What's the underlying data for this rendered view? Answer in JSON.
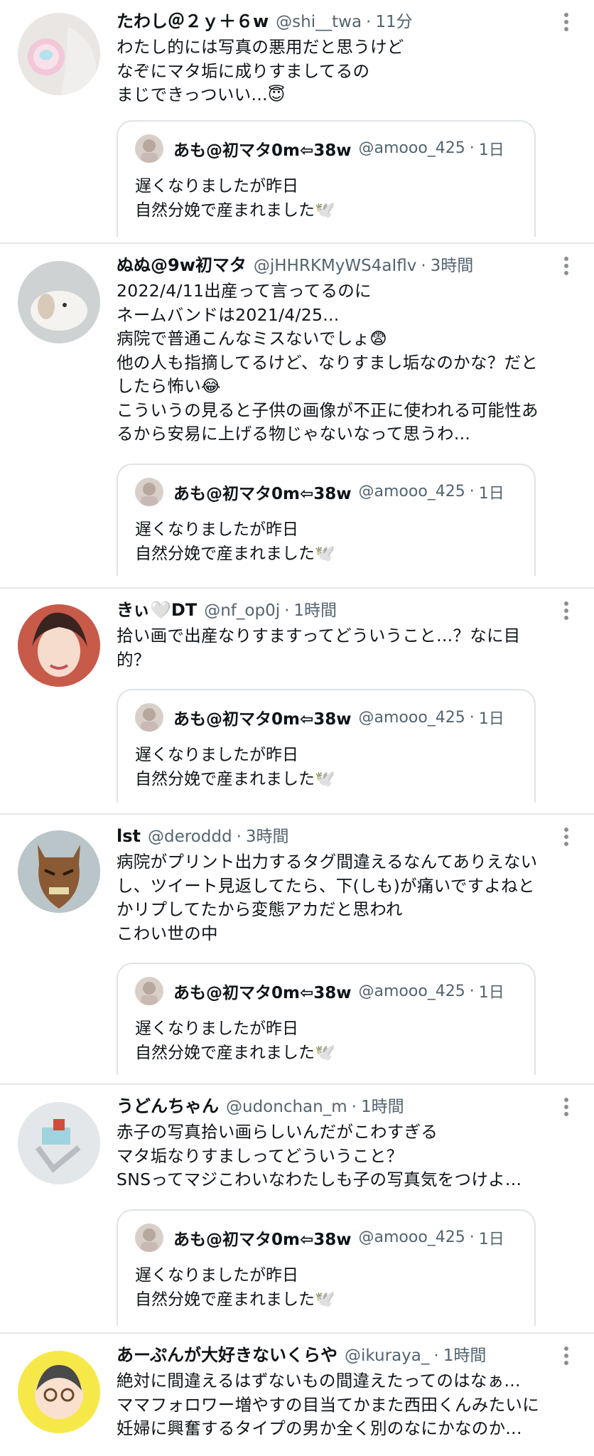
{
  "quoted": {
    "name": "あも@初マタ0m⇦38w",
    "handle": "@amooo_425",
    "time": "1日",
    "text": "遅くなりましたが昨日\n自然分娩で産まれました🕊️"
  },
  "tweets": [
    {
      "name": "たわし＠２ｙ＋６w",
      "handle": "@shi__twa",
      "time": "11分",
      "text": "わたし的には写真の悪用だと思うけど\nなぞにマタ垢に成りすましてるの\nまじできっついい...😇"
    },
    {
      "name": "ぬぬ@9w初マタ",
      "handle": "@jHHRKMyWS4aIflv",
      "time": "3時間",
      "text": "2022/4/11出産って言ってるのに\nネームバンドは2021/4/25...\n病院で普通こんなミスないでしょ😨\n他の人も指摘してるけど、なりすまし垢なのかな？だと\nしたら怖い😂\nこういうの見ると子供の画像が不正に使われる可能性あ\nるから安易に上げる物じゃないなって思うわ..."
    },
    {
      "name": "きぃ🤍DT",
      "handle": "@nf_op0j",
      "time": "1時間",
      "text": "拾い画で出産なりすますってどういうこと...？なに目\n的？"
    },
    {
      "name": "lst",
      "handle": "@deroddd",
      "time": "3時間",
      "text": "病院がプリント出力するタグ間違えるなんてありえない\nし、ツイート見返してたら、下(しも)が痛いですよねと\nかリプしてたから変態アカだと思われ\nこわい世の中"
    },
    {
      "name": "うどんちゃん",
      "handle": "@udonchan_m",
      "time": "1時間",
      "text": "赤子の写真拾い画らしいんだがこわすぎる\nマタ垢なりすましってどういうこと？\nSNSってマジこわいなわたしも子の写真気をつけよ..."
    },
    {
      "name": "あーぷんが大好きないくらや",
      "handle": "@ikuraya_",
      "time": "1時間",
      "text": "絶対に間違えるはずないもの間違えたってのはなぁ...\nママフォロワー増やすの目当てかまた西田くんみたいに\n妊婦に興奮するタイプの男か全く別のなにかなのか..."
    }
  ],
  "colors": {
    "secondary": "#536471",
    "primary": "#0f1419",
    "divider": "#e6e6e6"
  }
}
